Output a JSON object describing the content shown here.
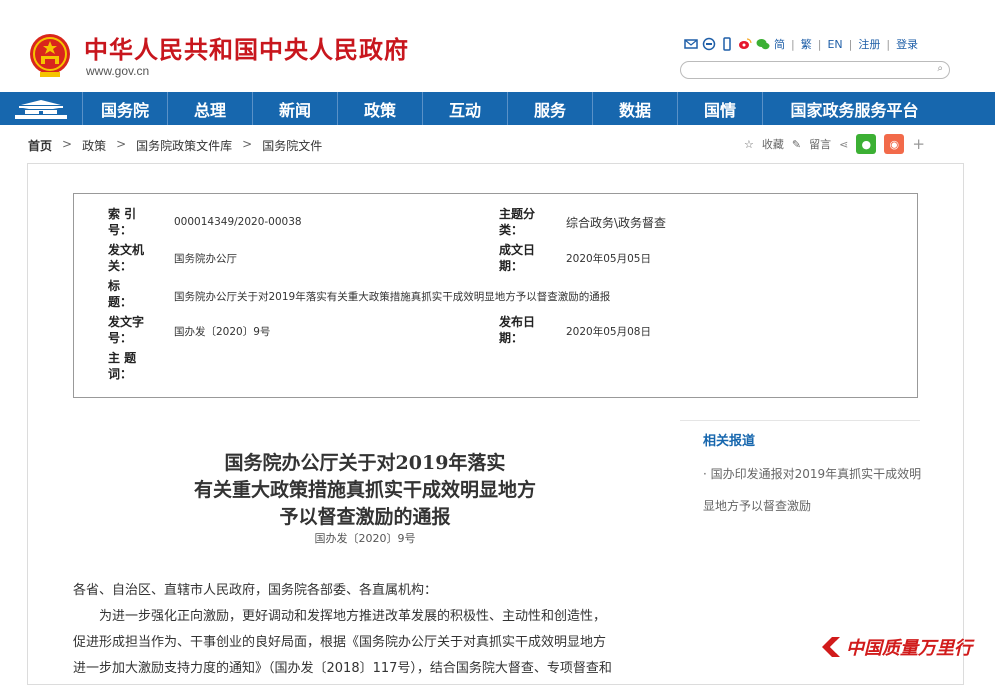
{
  "header": {
    "site_title": "中华人民共和国中央人民政府",
    "site_url": "www.gov.cn",
    "tools": {
      "traditional_simplified": "简",
      "traditional": "繁",
      "english": "EN",
      "register": "注册",
      "login": "登录"
    },
    "search_placeholder": ""
  },
  "nav": {
    "items": [
      {
        "label": "国务院"
      },
      {
        "label": "总理"
      },
      {
        "label": "新闻"
      },
      {
        "label": "政策"
      },
      {
        "label": "互动"
      },
      {
        "label": "服务"
      },
      {
        "label": "数据"
      },
      {
        "label": "国情"
      },
      {
        "label": "国家政务服务平台"
      }
    ]
  },
  "breadcrumb": {
    "home": "首页",
    "policy": "政策",
    "library": "国务院政策文件库",
    "current": "国务院文件"
  },
  "share": {
    "favorite": "收藏",
    "comment": "留言"
  },
  "meta": {
    "index_label": "索  引  号：",
    "index_value": "000014349/2020-00038",
    "category_label": "主题分类：",
    "category_value": "综合政务\\政务督查",
    "issuer_label": "发文机关：",
    "issuer_value": "国务院办公厅",
    "date_label": "成文日期：",
    "date_value": "2020年05月05日",
    "title_label": "标    题：",
    "title_value": "国务院办公厅关于对2019年落实有关重大政策措施真抓实干成效明显地方予以督查激励的通报",
    "docno_label": "发文字号：",
    "docno_value": "国办发〔2020〕9号",
    "publish_label": "发布日期：",
    "publish_value": "2020年05月08日",
    "keywords_label": "主  题  词："
  },
  "related": {
    "title": "相关报道",
    "items": [
      {
        "text": "· 国办印发通报对2019年真抓实干成效明显地方予以督查激励"
      }
    ]
  },
  "document": {
    "title_line1": "国务院办公厅关于对2019年落实",
    "title_line2": "有关重大政策措施真抓实干成效明显地方",
    "title_line3": "予以督查激励的通报",
    "doc_number": "国办发〔2020〕9号",
    "salutation": "各省、自治区、直辖市人民政府，国务院各部委、各直属机构：",
    "para1_line1": "为进一步强化正向激励，更好调动和发挥地方推进改革发展的积极性、主动性和创造性，",
    "para1_line2": "促进形成担当作为、干事创业的良好局面，根据《国务院办公厅关于对真抓实干成效明显地方",
    "para1_line3": "进一步加大激励支持力度的通知》（国办发〔2018〕117号），结合国务院大督查、专项督查和"
  },
  "watermark": {
    "text": "中国质量万里行"
  },
  "colors": {
    "brand_red": "#c8161d",
    "nav_blue": "#1767ae",
    "wechat_green": "#3cb034",
    "weibo_orange": "#f26a4a"
  }
}
